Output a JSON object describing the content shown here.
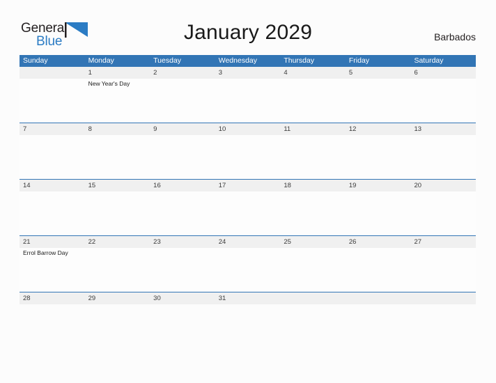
{
  "brand": {
    "name_top": "General",
    "name_bottom": "Blue",
    "flag_icon": "blue-triangle-flag-icon",
    "accent_color": "#2b7cc4"
  },
  "header": {
    "title": "January 2029",
    "country": "Barbados"
  },
  "theme": {
    "header_blue": "#3275b5",
    "date_band_gray": "#f0f0f0",
    "separator_blue": "#3275b5",
    "page_background": "#fcfcfc"
  },
  "calendar": {
    "month": "January",
    "year": "2029",
    "weekday_headers": [
      "Sunday",
      "Monday",
      "Tuesday",
      "Wednesday",
      "Thursday",
      "Friday",
      "Saturday"
    ],
    "weeks": [
      {
        "days": [
          {
            "date": "",
            "events": []
          },
          {
            "date": "1",
            "events": [
              "New Year's Day"
            ]
          },
          {
            "date": "2",
            "events": []
          },
          {
            "date": "3",
            "events": []
          },
          {
            "date": "4",
            "events": []
          },
          {
            "date": "5",
            "events": []
          },
          {
            "date": "6",
            "events": []
          }
        ]
      },
      {
        "days": [
          {
            "date": "7",
            "events": []
          },
          {
            "date": "8",
            "events": []
          },
          {
            "date": "9",
            "events": []
          },
          {
            "date": "10",
            "events": []
          },
          {
            "date": "11",
            "events": []
          },
          {
            "date": "12",
            "events": []
          },
          {
            "date": "13",
            "events": []
          }
        ]
      },
      {
        "days": [
          {
            "date": "14",
            "events": []
          },
          {
            "date": "15",
            "events": []
          },
          {
            "date": "16",
            "events": []
          },
          {
            "date": "17",
            "events": []
          },
          {
            "date": "18",
            "events": []
          },
          {
            "date": "19",
            "events": []
          },
          {
            "date": "20",
            "events": []
          }
        ]
      },
      {
        "days": [
          {
            "date": "21",
            "events": [
              "Errol Barrow Day"
            ]
          },
          {
            "date": "22",
            "events": []
          },
          {
            "date": "23",
            "events": []
          },
          {
            "date": "24",
            "events": []
          },
          {
            "date": "25",
            "events": []
          },
          {
            "date": "26",
            "events": []
          },
          {
            "date": "27",
            "events": []
          }
        ]
      },
      {
        "days": [
          {
            "date": "28",
            "events": []
          },
          {
            "date": "29",
            "events": []
          },
          {
            "date": "30",
            "events": []
          },
          {
            "date": "31",
            "events": []
          },
          {
            "date": "",
            "events": []
          },
          {
            "date": "",
            "events": []
          },
          {
            "date": "",
            "events": []
          }
        ]
      }
    ]
  }
}
